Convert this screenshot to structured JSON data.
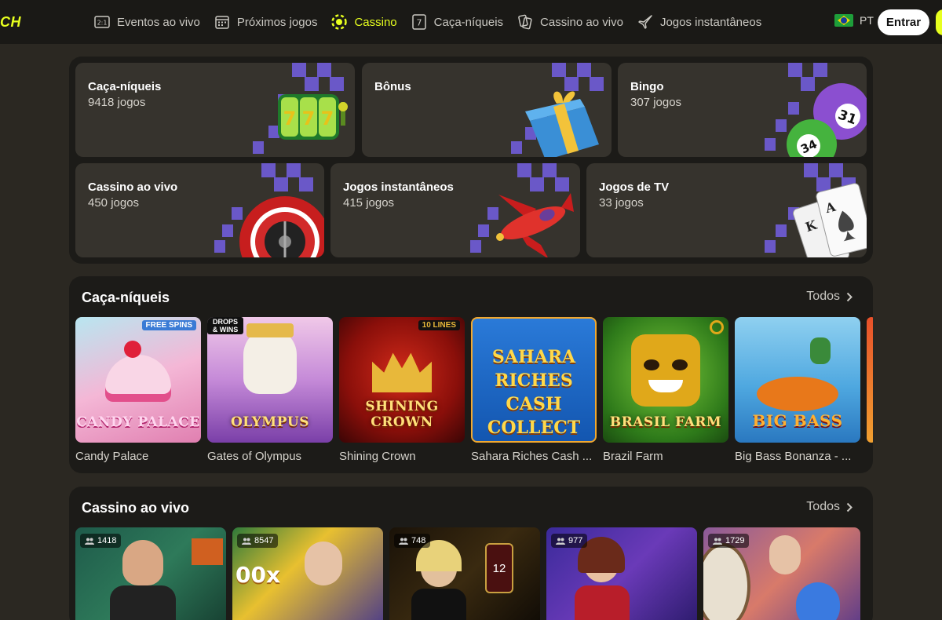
{
  "header": {
    "logo": "CH",
    "nav": [
      {
        "label": "Eventos ao vivo",
        "icon": "live-events-icon"
      },
      {
        "label": "Próximos jogos",
        "icon": "calendar-icon"
      },
      {
        "label": "Cassino",
        "icon": "casino-chip-icon",
        "active": true
      },
      {
        "label": "Caça-níqueis",
        "icon": "slot-icon"
      },
      {
        "label": "Cassino ao vivo",
        "icon": "live-casino-icon"
      },
      {
        "label": "Jogos instantâneos",
        "icon": "plane-icon"
      }
    ],
    "language": "PT",
    "login_label": "Entrar"
  },
  "categories": [
    {
      "name": "Caça-níqueis",
      "count": "9418 jogos",
      "art": "slot-reels-icon"
    },
    {
      "name": "Bônus",
      "count": "",
      "art": "gift-box-icon"
    },
    {
      "name": "Bingo",
      "count": "307 jogos",
      "art": "bingo-balls-icon"
    },
    {
      "name": "Cassino ao vivo",
      "count": "450 jogos",
      "art": "roulette-wheel-icon"
    },
    {
      "name": "Jogos instantâneos",
      "count": "415 jogos",
      "art": "airplane-icon"
    },
    {
      "name": "Jogos de TV",
      "count": "33 jogos",
      "art": "playing-cards-icon"
    }
  ],
  "slots_section": {
    "title": "Caça-níqueis",
    "see_all": "Todos",
    "games": [
      {
        "name": "Candy Palace",
        "art_text": "CANDY PALACE",
        "badge": "FREE SPINS"
      },
      {
        "name": "Gates of Olympus",
        "art_text": "OLYMPUS",
        "badge": "DROPS & WINS"
      },
      {
        "name": "Shining Crown",
        "art_text": "SHINING CROWN",
        "badge": "10 LINES"
      },
      {
        "name": "Sahara Riches Cash ...",
        "art_text": "SAHARA RICHES CASH COLLECT",
        "badge": ""
      },
      {
        "name": "Brazil Farm",
        "art_text": "BRASIL FARM",
        "badge": ""
      },
      {
        "name": "Big Bass Bonanza - ...",
        "art_text": "BIG BASS",
        "badge": ""
      }
    ]
  },
  "live_section": {
    "title": "Cassino ao vivo",
    "see_all": "Todos",
    "games": [
      {
        "players": "1418"
      },
      {
        "players": "8547"
      },
      {
        "players": "748",
        "overlay": "12"
      },
      {
        "players": "977"
      },
      {
        "players": "1729"
      }
    ]
  },
  "colors": {
    "accent": "#e7ff1f",
    "background": "#2b2822",
    "panel": "#1c1b18",
    "card": "#36332d",
    "purple_pattern": "#6a58c8"
  }
}
